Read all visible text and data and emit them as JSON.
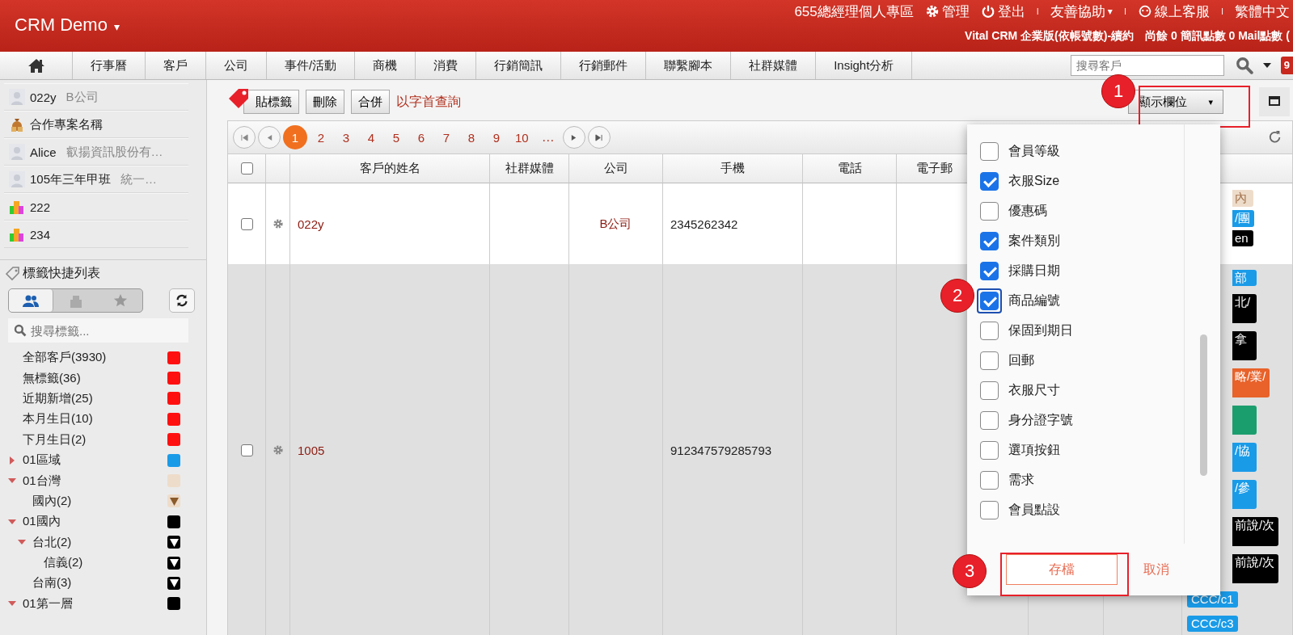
{
  "header": {
    "brand": "CRM Demo",
    "caret": "▾",
    "top_links": [
      {
        "kind": "text",
        "label": "655總經理個人專區"
      },
      {
        "kind": "gear",
        "label": "管理"
      },
      {
        "kind": "power",
        "label": "登出"
      },
      {
        "kind": "sep",
        "label": "I"
      },
      {
        "kind": "menu",
        "label": "友善協助",
        "caret": "▾"
      },
      {
        "kind": "sep",
        "label": "I"
      },
      {
        "kind": "chat",
        "label": "線上客服"
      },
      {
        "kind": "sep",
        "label": "I"
      },
      {
        "kind": "text",
        "label": "繁體中文"
      }
    ],
    "plan": "Vital CRM 企業版(依帳號數)-續約",
    "points": "尚餘 0 簡訊點數 0 Mail點數 ("
  },
  "nav": {
    "tabs": [
      {
        "label": "行事曆"
      },
      {
        "label": "客戶"
      },
      {
        "label": "公司"
      },
      {
        "label": "事件/活動"
      },
      {
        "label": "商機"
      },
      {
        "label": "消費"
      },
      {
        "label": "行銷簡訊"
      },
      {
        "label": "行銷郵件"
      },
      {
        "label": "聯繫腳本"
      },
      {
        "label": "社群媒體"
      },
      {
        "label": "Insight分析"
      }
    ],
    "search": {
      "placeholder": "搜尋客戶"
    },
    "badge": "9"
  },
  "sidebar": {
    "recent": [
      {
        "kind": "person",
        "name": "022y",
        "sub": "B公司"
      },
      {
        "kind": "deal",
        "name": "合作專案名稱"
      },
      {
        "kind": "person",
        "name": "Alice",
        "sub": "叡揚資訊股份有…"
      },
      {
        "kind": "person",
        "name": "105年三年甲班",
        "sub": "統一…"
      },
      {
        "kind": "company",
        "name": "222"
      },
      {
        "kind": "company",
        "name": "234"
      }
    ],
    "tags_title": "標籤快捷列表",
    "segments": [
      {
        "kind": "people",
        "selected": true
      },
      {
        "kind": "company",
        "selected": false
      },
      {
        "kind": "star",
        "selected": false
      }
    ],
    "tag_search": {
      "placeholder": "搜尋標籤..."
    },
    "tree": [
      {
        "label": "全部客戶(3930)",
        "color": "#ff1010"
      },
      {
        "label": "無標籤(36)",
        "color": "#ff1010"
      },
      {
        "label": "近期新增(25)",
        "color": "#ff1010"
      },
      {
        "label": "本月生日(10)",
        "color": "#ff1010"
      },
      {
        "label": "下月生日(2)",
        "color": "#ff1010"
      },
      {
        "label": "01區域",
        "color": "#1a9be8",
        "expanded": false
      },
      {
        "label": "01台灣",
        "color": "#eedcca",
        "expanded": true,
        "children": [
          {
            "label": "國內(2)",
            "color": "#eedcca",
            "filter": true
          }
        ]
      },
      {
        "label": "01國內",
        "color": "#000000",
        "expanded": true,
        "children": [
          {
            "label": "台北(2)",
            "color": "#000000",
            "filter": true,
            "expanded": true,
            "children": [
              {
                "label": "信義(2)",
                "color": "#000000",
                "filter": true
              }
            ]
          },
          {
            "label": "台南(3)",
            "color": "#000000",
            "filter": true
          }
        ]
      },
      {
        "label": "01第一層",
        "color": "#000000",
        "expanded": true
      }
    ]
  },
  "toolbar": {
    "buttons": [
      {
        "kind": "tag",
        "label": "貼標籤"
      },
      {
        "kind": "plain",
        "label": "刪除"
      },
      {
        "kind": "plain",
        "label": "合併"
      }
    ],
    "link": "以字首查詢",
    "columns_button": "顯示欄位",
    "columns_caret": "▾"
  },
  "pager": {
    "pages": [
      {
        "label": "1",
        "selected": true
      },
      {
        "label": "2",
        "selected": false
      },
      {
        "label": "3",
        "selected": false
      },
      {
        "label": "4",
        "selected": false
      },
      {
        "label": "5",
        "selected": false
      },
      {
        "label": "6",
        "selected": false
      },
      {
        "label": "7",
        "selected": false
      },
      {
        "label": "8",
        "selected": false
      },
      {
        "label": "9",
        "selected": false
      },
      {
        "label": "10",
        "selected": false
      }
    ],
    "more": "…"
  },
  "table": {
    "select_all_checked": false,
    "columns": [
      "客戶的姓名",
      "社群媒體",
      "公司",
      "手機",
      "電話",
      "電子郵"
    ],
    "rows": [
      {
        "checked": false,
        "name": "022y",
        "company": "B公司",
        "mobile": "2345262342",
        "tags": [
          {
            "label": "內",
            "color": "#eedcca",
            "partly_hidden": true
          },
          {
            "label": "/團",
            "color": "#1a9be8",
            "partly_hidden": true
          },
          {
            "label": "en",
            "color": "#000000",
            "partly_hidden": true
          }
        ]
      },
      {
        "checked": false,
        "name": "1005",
        "mobile": "912347579285793",
        "tags": [
          {
            "label": "部",
            "color": "#1a9be8",
            "partly_hidden": true
          },
          {
            "label": "北/",
            "color": "#000000",
            "partly_hidden": true
          },
          {
            "label": "拿",
            "color": "#000000",
            "partly_hidden": true
          },
          {
            "label": "略/業/",
            "color": "#e8622a",
            "partly_hidden": true
          },
          {
            "color": "#1b9e6e",
            "partly_hidden": true
          },
          {
            "label": "/協",
            "color": "#1a9be8",
            "partly_hidden": true
          },
          {
            "label": "/參",
            "color": "#1a9be8",
            "partly_hidden": true
          },
          {
            "label": "前說/次",
            "color": "#000000",
            "partly_hidden": true
          },
          {
            "label": "前說/次",
            "color": "#000000",
            "partly_hidden": true
          },
          {
            "label": "CCC/c1",
            "color": "#1a9be8",
            "partly_hidden": false
          },
          {
            "label": "CCC/c3",
            "color": "#1a9be8",
            "partly_hidden": false
          }
        ]
      }
    ]
  },
  "column_menu": {
    "items": [
      {
        "label": "會員等級",
        "checked": false
      },
      {
        "label": "衣服Size",
        "checked": true
      },
      {
        "label": "優惠碼",
        "checked": false
      },
      {
        "label": "案件類別",
        "checked": true
      },
      {
        "label": "採購日期",
        "checked": true
      },
      {
        "label": "商品編號",
        "checked": true,
        "focused": true
      },
      {
        "label": "保固到期日",
        "checked": false
      },
      {
        "label": "回郵",
        "checked": false
      },
      {
        "label": "衣服尺寸",
        "checked": false
      },
      {
        "label": "身分證字號",
        "checked": false
      },
      {
        "label": "選項按鈕",
        "checked": false
      },
      {
        "label": "需求",
        "checked": false
      },
      {
        "label": "會員點設",
        "checked": false
      }
    ],
    "save": "存檔",
    "cancel": "取消"
  },
  "annotations": [
    "1",
    "2",
    "3"
  ]
}
